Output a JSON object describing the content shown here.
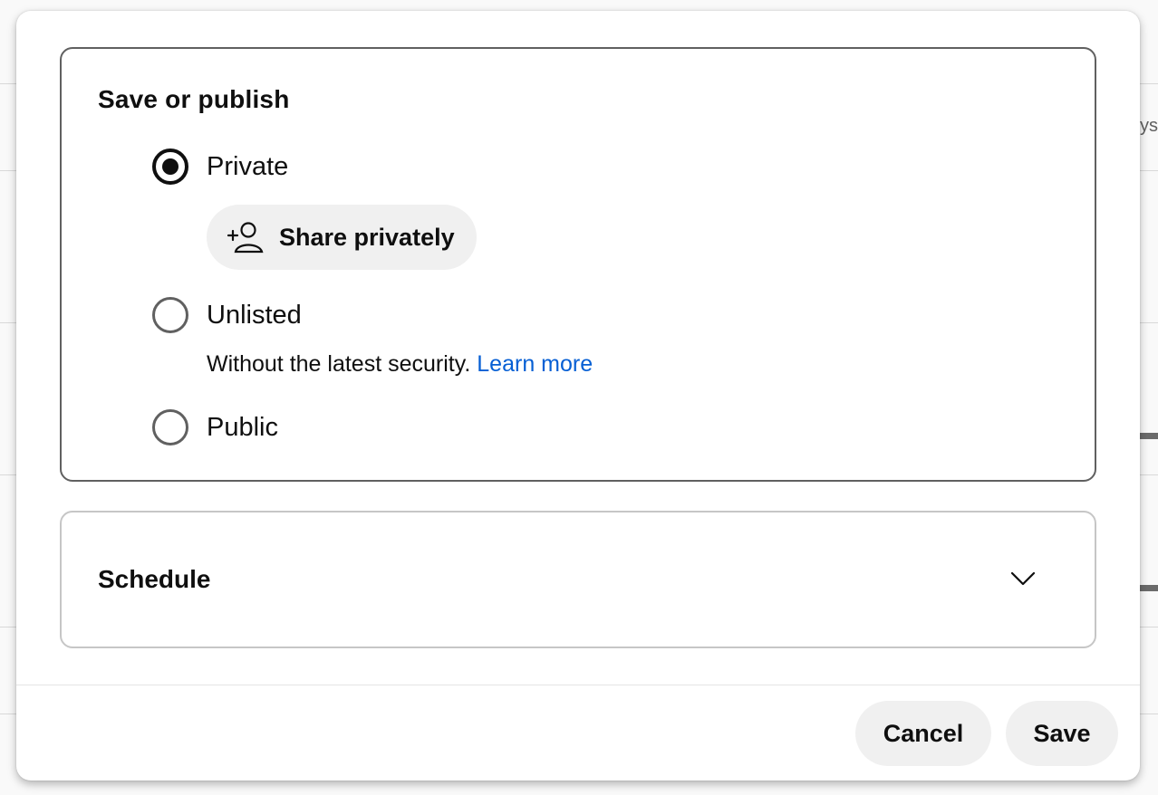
{
  "background": {
    "partial_text": "ys"
  },
  "dialog": {
    "visibility_section": {
      "title": "Save or publish",
      "options": [
        {
          "label": "Private",
          "selected": true
        },
        {
          "label": "Unlisted",
          "selected": false
        },
        {
          "label": "Public",
          "selected": false
        }
      ],
      "share_button": {
        "label": "Share privately",
        "icon": "add-person-icon"
      },
      "unlisted_helper": {
        "text": "Without the latest security.",
        "link": "Learn more"
      }
    },
    "schedule_section": {
      "title": "Schedule",
      "icon": "chevron-down-icon"
    },
    "footer": {
      "cancel_label": "Cancel",
      "save_label": "Save"
    }
  },
  "colors": {
    "link": "#065fd4",
    "pill_bg": "#f0f0f0",
    "text": "#0f0f0f"
  }
}
